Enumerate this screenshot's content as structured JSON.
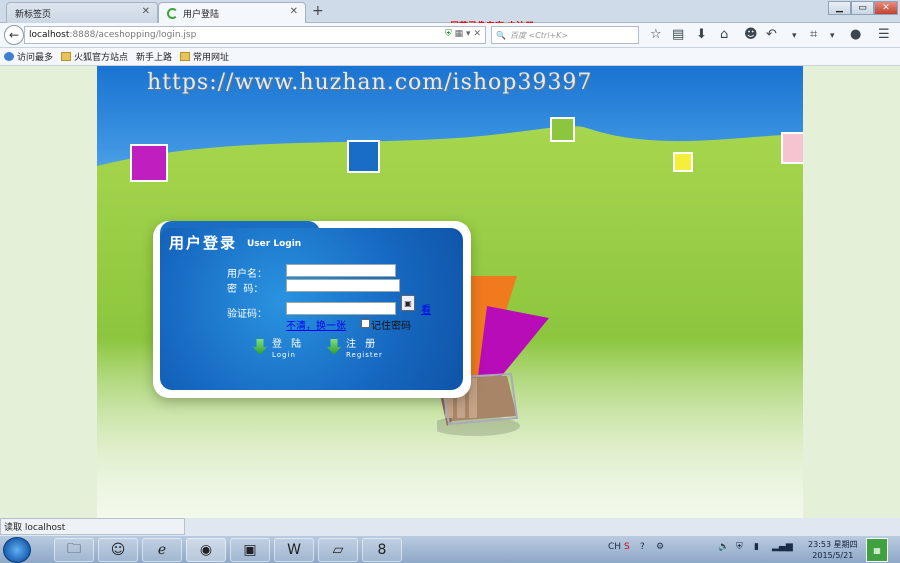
{
  "tabs": [
    {
      "label": "新标签页",
      "active": false
    },
    {
      "label": "用户登陆",
      "active": true
    }
  ],
  "recording_banner": "屏幕录像专家 未注册",
  "address": {
    "host": "localhost",
    "path": ":8888/aceshopping/login.jsp"
  },
  "search": {
    "placeholder": "百度 <Ctrl+K>"
  },
  "bookmarks": [
    {
      "label": "访问最多",
      "icon": "globe-icon"
    },
    {
      "label": "火狐官方站点",
      "icon": "folder-icon"
    },
    {
      "label": "新手上路",
      "icon": "page-icon"
    },
    {
      "label": "常用网址",
      "icon": "folder-icon"
    }
  ],
  "watermark": "https://www.huzhan.com/ishop39397",
  "login": {
    "title": "用户登录",
    "subtitle": "User Login",
    "username_label": "用户名：",
    "password_label": "密  码：",
    "captcha_label": "验证码：",
    "captcha_see": "看",
    "refresh_link": "不清，换一张",
    "remember_label": "记住密码",
    "login_button": {
      "cn": "登 陆",
      "en": "Login"
    },
    "register_button": {
      "cn": "注 册",
      "en": "Register"
    }
  },
  "statusbar": "读取 localhost",
  "taskbar": {
    "apps": [
      "file-explorer-icon",
      "qq-icon",
      "internet-explorer-icon",
      "firefox-icon",
      "powerpoint-icon",
      "word-icon",
      "notepad-icon",
      "editor-icon"
    ],
    "tray_lang": "CH",
    "clock_time": "23:53 星期四",
    "clock_date": "2015/5/21"
  },
  "colors": {
    "accent": "#1a6fc9",
    "grass": "#8cc63e",
    "sky": "#3d95e2"
  }
}
